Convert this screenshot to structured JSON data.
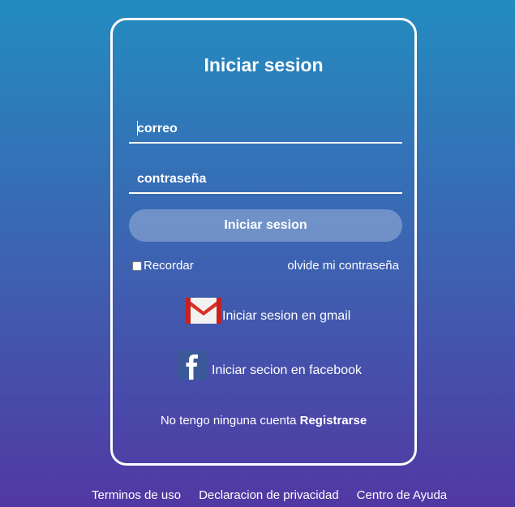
{
  "login_card": {
    "title": "Iniciar sesion",
    "email_placeholder": "correo",
    "password_placeholder": "contraseña",
    "login_button": "Iniciar sesion",
    "remember_label": "Recordar",
    "remember_checked": false,
    "forgot_link": "olvide mi contraseña",
    "gmail_login": "Iniciar sesion en gmail",
    "facebook_login": "Iniciar secion en facebook",
    "no_account_text": "No tengo ninguna cuenta",
    "register_link": "Registrarse"
  },
  "icons": {
    "gmail": "gmail-icon",
    "facebook": "facebook-icon"
  },
  "colors": {
    "background_top": "#238cbf",
    "background_bottom": "#5138a3",
    "facebook_blue": "#3b5998",
    "gmail_red": "#d93025"
  },
  "footer": {
    "links": [
      "Terminos de uso",
      "Declaracion de privacidad",
      "Centro de Ayuda"
    ]
  }
}
